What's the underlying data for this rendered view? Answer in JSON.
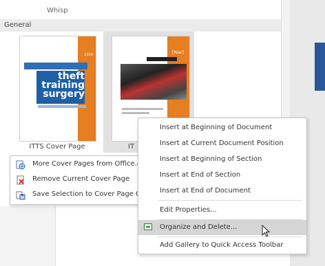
{
  "gallery": {
    "prev_item_label": "Whisp",
    "section_header": "General",
    "thumbnails": [
      {
        "label": "ITTS Cover Page",
        "year": "2016",
        "title": "theft training surgery"
      },
      {
        "label": "IT",
        "year": "[Year]"
      }
    ]
  },
  "left_menu": {
    "items": [
      {
        "label": "More Cover Pages from Office.com",
        "icon": "globe-doc-icon"
      },
      {
        "label": "Remove Current Cover Page",
        "icon": "remove-page-icon"
      },
      {
        "label": "Save Selection to Cover Page Gallery...",
        "icon": "save-gallery-icon"
      }
    ]
  },
  "right_menu": {
    "items": [
      {
        "label": "Insert at Beginning of Document"
      },
      {
        "label": "Insert at Current Document Position"
      },
      {
        "label": "Insert at Beginning of Section"
      },
      {
        "label": "Insert at End of Section"
      },
      {
        "label": "Insert at End of Document"
      },
      {
        "label": "Edit Properties..."
      },
      {
        "label": "Organize and Delete...",
        "highlighted": true,
        "icon": "organize-icon"
      },
      {
        "label": "Add Gallery to Quick Access Toolbar"
      }
    ]
  }
}
